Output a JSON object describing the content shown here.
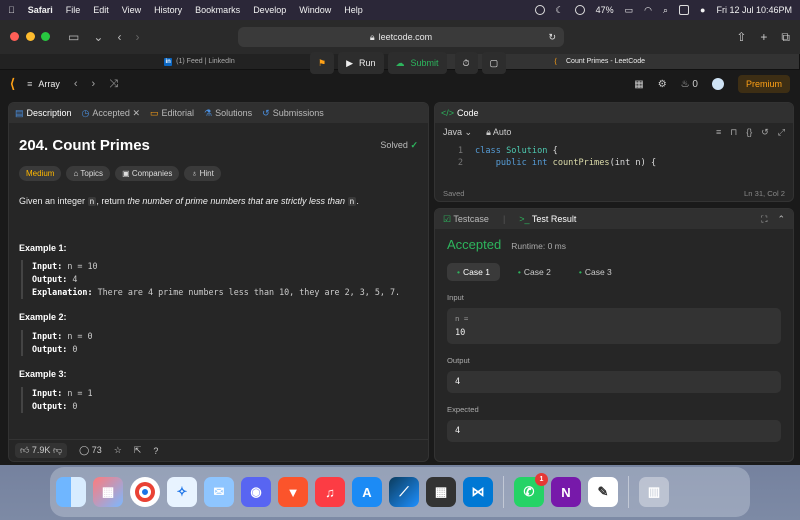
{
  "menubar": {
    "app": "Safari",
    "items": [
      "File",
      "Edit",
      "View",
      "History",
      "Bookmarks",
      "Develop",
      "Window",
      "Help"
    ],
    "battery": "47%",
    "datetime": "Fri 12 Jul  10:46PM"
  },
  "browser": {
    "url": "leetcode.com",
    "tabs": [
      {
        "label": "(1) Feed | LinkedIn",
        "active": false
      },
      {
        "label": "Count Primes - LeetCode",
        "active": true
      }
    ]
  },
  "lcnav": {
    "list": "Array",
    "run": "Run",
    "submit": "Submit",
    "streak": "0",
    "premium": "Premium"
  },
  "description_panel": {
    "tabs": [
      "Description",
      "Accepted",
      "Editorial",
      "Solutions",
      "Submissions"
    ],
    "title": "204. Count Primes",
    "solved": "Solved",
    "difficulty": "Medium",
    "chips": [
      "Topics",
      "Companies",
      "Hint"
    ],
    "statement_pre": "Given an integer ",
    "statement_code": "n",
    "statement_mid": ", return ",
    "statement_em": "the number of prime numbers that are strictly less than",
    "statement_code2": "n",
    "statement_end": ".",
    "examples": [
      {
        "heading": "Example 1:",
        "input": "n = 10",
        "output": "4",
        "explanation": "There are 4 prime numbers less than 10, they are 2, 3, 5, 7."
      },
      {
        "heading": "Example 2:",
        "input": "n = 0",
        "output": "0"
      },
      {
        "heading": "Example 3:",
        "input": "n = 1",
        "output": "0"
      }
    ],
    "labels": {
      "input": "Input:",
      "output": "Output:",
      "explanation": "Explanation:"
    },
    "likes": "7.9K",
    "comments": "73"
  },
  "code_panel": {
    "title": "Code",
    "language": "Java",
    "mode": "Auto",
    "lines": [
      {
        "n": "1",
        "kw": "class",
        "name": "Solution",
        "rest": " {"
      },
      {
        "n": "2",
        "kw": "public int",
        "name": "countPrimes",
        "rest": "(int n) {"
      }
    ],
    "saved": "Saved",
    "cursor": "Ln 31, Col 2"
  },
  "result_panel": {
    "tabs": [
      "Testcase",
      "Test Result"
    ],
    "status": "Accepted",
    "runtime": "Runtime: 0 ms",
    "cases": [
      "Case 1",
      "Case 2",
      "Case 3"
    ],
    "input_label": "Input",
    "input_var": "n =",
    "input_value": "10",
    "output_label": "Output",
    "output_value": "4",
    "expected_label": "Expected",
    "expected_value": "4"
  },
  "dock": {
    "whatsapp_badge": "1"
  }
}
